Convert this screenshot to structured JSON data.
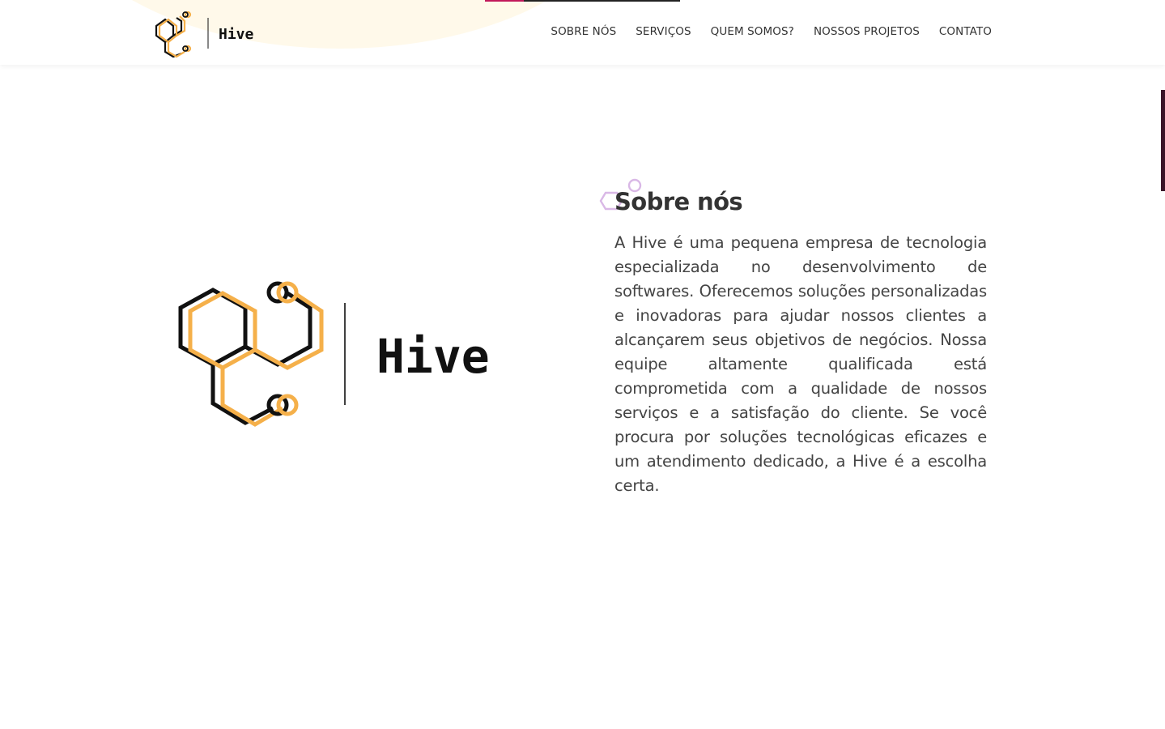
{
  "brand": {
    "name": "Hive",
    "colors": {
      "accent": "#f5b04a",
      "dark": "#111111",
      "deco_purple": "#d9b8e6",
      "text": "#333333"
    }
  },
  "nav": {
    "items": [
      {
        "label": "SOBRE NÓS"
      },
      {
        "label": "SERVIÇOS"
      },
      {
        "label": "QUEM SOMOS?"
      },
      {
        "label": "NOSSOS PROJETOS"
      },
      {
        "label": "CONTATO"
      }
    ]
  },
  "about": {
    "title": "Sobre nós",
    "text": "A Hive é uma pequena empresa de tecnologia especializada no desenvolvimento de softwares. Oferecemos soluções personalizadas e inovadoras para ajudar nossos clientes a alcançarem seus objetivos de negócios. Nossa equipe altamente qualificada está comprometida com a qualidade de nossos serviços e a satisfação do cliente. Se você procura por soluções tecnológicas eficazes e um atendimento dedicado, a Hive é a escolha certa."
  }
}
